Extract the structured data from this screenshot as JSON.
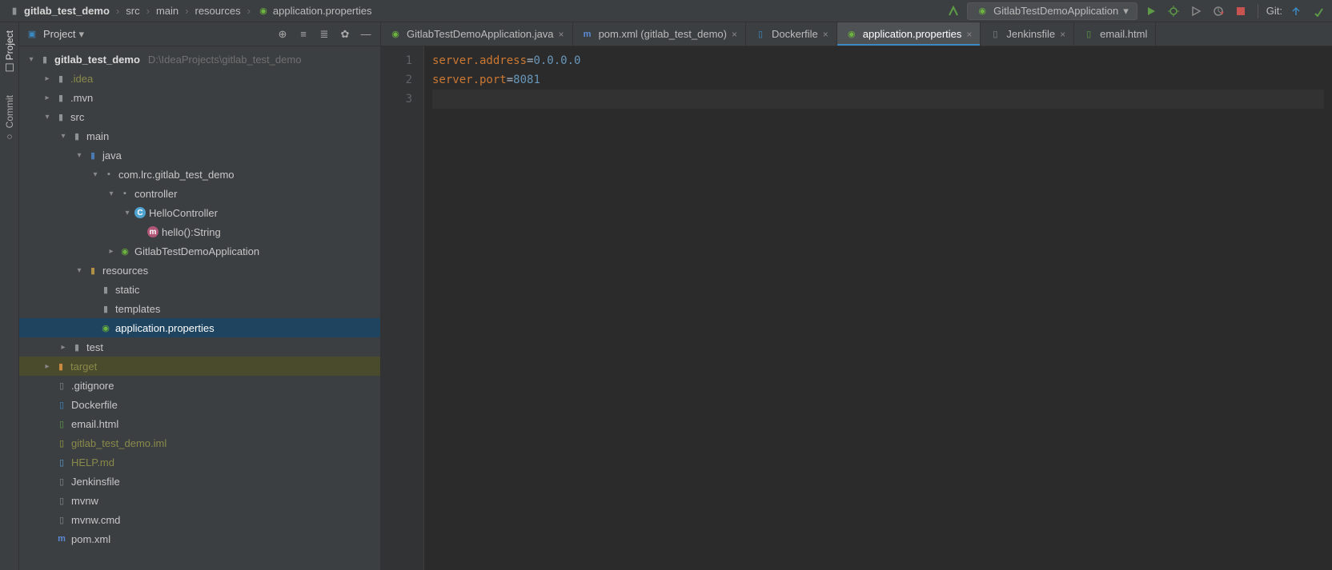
{
  "breadcrumbs": {
    "project": "gitlab_test_demo",
    "p1": "src",
    "p2": "main",
    "p3": "resources",
    "file": "application.properties"
  },
  "run_config": {
    "label": "GitlabTestDemoApplication"
  },
  "git": {
    "label": "Git:"
  },
  "left_tabs": {
    "project": "Project",
    "commit": "Commit"
  },
  "panel": {
    "title": "Project"
  },
  "tree": {
    "root": {
      "name": "gitlab_test_demo",
      "path": "D:\\IdeaProjects\\gitlab_test_demo"
    },
    "idea": ".idea",
    "mvn": ".mvn",
    "src": "src",
    "main": "main",
    "java": "java",
    "pkg": "com.lrc.gitlab_test_demo",
    "controller": "controller",
    "hello_ctrl": "HelloController",
    "hello_method": "hello():String",
    "app_class": "GitlabTestDemoApplication",
    "resources": "resources",
    "static": "static",
    "templates": "templates",
    "app_props": "application.properties",
    "test": "test",
    "target": "target",
    "gitignore": ".gitignore",
    "dockerfile": "Dockerfile",
    "emailhtml": "email.html",
    "iml": "gitlab_test_demo.iml",
    "help": "HELP.md",
    "jenkins": "Jenkinsfile",
    "mvnw": "mvnw",
    "mvnwcmd": "mvnw.cmd",
    "pom": "pom.xml"
  },
  "tabs": {
    "t1": "GitlabTestDemoApplication.java",
    "t2": "pom.xml (gitlab_test_demo)",
    "t3": "Dockerfile",
    "t4": "application.properties",
    "t5": "Jenkinsfile",
    "t6": "email.html"
  },
  "code": {
    "l1": {
      "k": "server.address",
      "v": "0.0.0.0"
    },
    "l2": {
      "k": "server.port",
      "v": "8081"
    }
  },
  "gutter": {
    "n1": "1",
    "n2": "2",
    "n3": "3"
  }
}
